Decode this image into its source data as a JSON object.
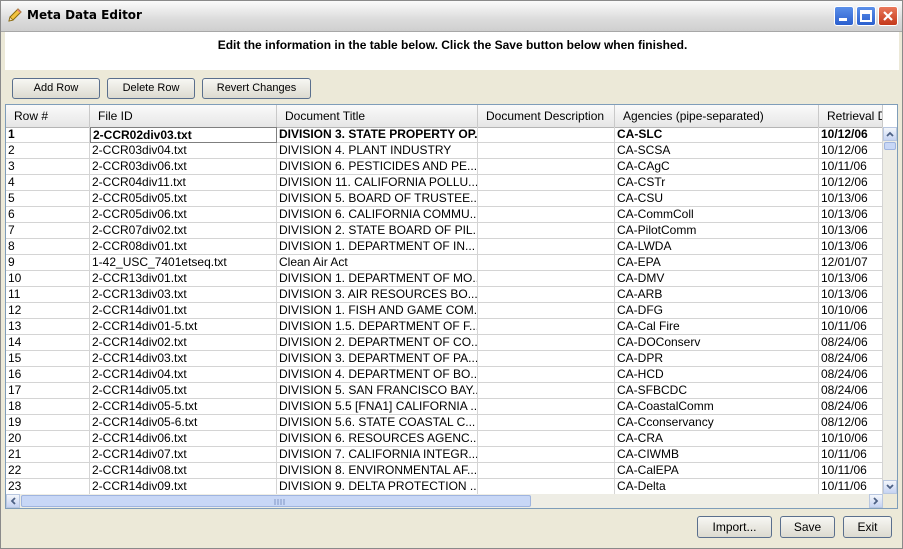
{
  "window": {
    "title": "Meta Data Editor",
    "icon": "pencil-icon"
  },
  "instructions": "Edit the information in the table below.  Click the Save button below when finished.",
  "toolbar": {
    "add_row": "Add Row",
    "delete_row": "Delete Row",
    "revert": "Revert Changes"
  },
  "table": {
    "columns": [
      "Row #",
      "File ID",
      "Document Title",
      "Document Description",
      "Agencies (pipe-separated)",
      "Retrieval D"
    ],
    "rows": [
      [
        "1",
        "2-CCR02div03.txt",
        "DIVISION 3. STATE PROPERTY OP...",
        "",
        "CA-SLC",
        "10/12/06"
      ],
      [
        "2",
        "2-CCR03div04.txt",
        "DIVISION 4. PLANT INDUSTRY",
        "",
        "CA-SCSA",
        "10/12/06"
      ],
      [
        "3",
        "2-CCR03div06.txt",
        "DIVISION 6. PESTICIDES AND PE...",
        "",
        "CA-CAgC",
        "10/11/06"
      ],
      [
        "4",
        "2-CCR04div11.txt",
        "DIVISION 11. CALIFORNIA POLLU...",
        "",
        "CA-CSTr",
        "10/12/06"
      ],
      [
        "5",
        "2-CCR05div05.txt",
        "DIVISION 5. BOARD OF TRUSTEE...",
        "",
        "CA-CSU",
        "10/13/06"
      ],
      [
        "6",
        "2-CCR05div06.txt",
        "DIVISION 6. CALIFORNIA COMMU...",
        "",
        "CA-CommColl",
        "10/13/06"
      ],
      [
        "7",
        "2-CCR07div02.txt",
        "DIVISION 2. STATE BOARD OF PIL...",
        "",
        "CA-PilotComm",
        "10/13/06"
      ],
      [
        "8",
        "2-CCR08div01.txt",
        "DIVISION 1. DEPARTMENT OF IN...",
        "",
        "CA-LWDA",
        "10/13/06"
      ],
      [
        "9",
        "1-42_USC_7401etseq.txt",
        "Clean Air Act",
        "",
        "CA-EPA",
        "12/01/07"
      ],
      [
        "10",
        "2-CCR13div01.txt",
        "DIVISION 1. DEPARTMENT OF MO...",
        "",
        "CA-DMV",
        "10/13/06"
      ],
      [
        "11",
        "2-CCR13div03.txt",
        "DIVISION 3. AIR RESOURCES BO...",
        "",
        "CA-ARB",
        "10/13/06"
      ],
      [
        "12",
        "2-CCR14div01.txt",
        "DIVISION 1. FISH AND GAME COM...",
        "",
        "CA-DFG",
        "10/10/06"
      ],
      [
        "13",
        "2-CCR14div01-5.txt",
        "DIVISION 1.5. DEPARTMENT OF F...",
        "",
        "CA-Cal Fire",
        "10/11/06"
      ],
      [
        "14",
        "2-CCR14div02.txt",
        "DIVISION 2. DEPARTMENT OF CO...",
        "",
        "CA-DOConserv",
        "08/24/06"
      ],
      [
        "15",
        "2-CCR14div03.txt",
        "DIVISION 3. DEPARTMENT OF PA...",
        "",
        "CA-DPR",
        "08/24/06"
      ],
      [
        "16",
        "2-CCR14div04.txt",
        "DIVISION 4. DEPARTMENT OF BO...",
        "",
        "CA-HCD",
        "08/24/06"
      ],
      [
        "17",
        "2-CCR14div05.txt",
        "DIVISION 5. SAN FRANCISCO BAY...",
        "",
        "CA-SFBCDC",
        "08/24/06"
      ],
      [
        "18",
        "2-CCR14div05-5.txt",
        "DIVISION 5.5 [FNA1] CALIFORNIA ...",
        "",
        "CA-CoastalComm",
        "08/24/06"
      ],
      [
        "19",
        "2-CCR14div05-6.txt",
        "DIVISION 5.6. STATE COASTAL C...",
        "",
        "CA-Cconservancy",
        "08/12/06"
      ],
      [
        "20",
        "2-CCR14div06.txt",
        "DIVISION 6. RESOURCES AGENC...",
        "",
        "CA-CRA",
        "10/10/06"
      ],
      [
        "21",
        "2-CCR14div07.txt",
        "DIVISION 7. CALIFORNIA INTEGR...",
        "",
        "CA-CIWMB",
        "10/11/06"
      ],
      [
        "22",
        "2-CCR14div08.txt",
        "DIVISION 8. ENVIRONMENTAL AF...",
        "",
        "CA-CalEPA",
        "10/11/06"
      ],
      [
        "23",
        "2-CCR14div09.txt",
        "DIVISION 9. DELTA PROTECTION ...",
        "",
        "CA-Delta",
        "10/11/06"
      ]
    ]
  },
  "footer": {
    "import": "Import...",
    "save": "Save",
    "exit": "Exit"
  }
}
